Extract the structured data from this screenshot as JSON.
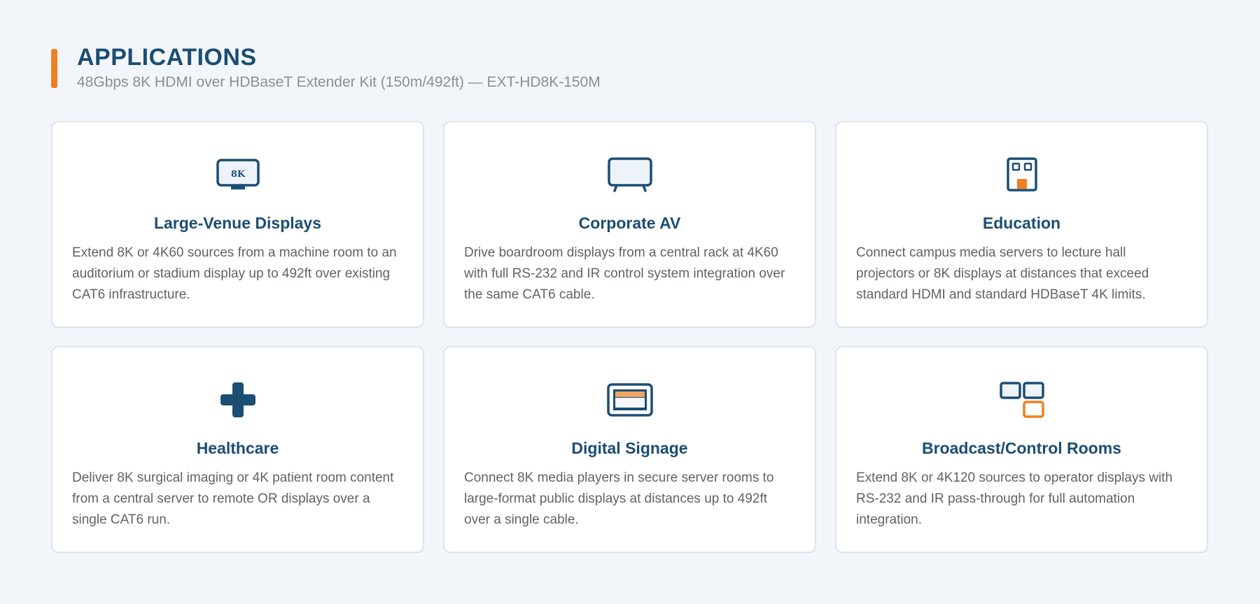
{
  "header": {
    "title": "APPLICATIONS",
    "subtitle": "48Gbps 8K HDMI over HDBaseT Extender Kit (150m/492ft) — EXT-HD8K-150M"
  },
  "colors": {
    "accent": "#f07f22",
    "primary": "#1c4d73",
    "text": "#5f6368",
    "background": "#f2f6fa"
  },
  "cards": [
    {
      "icon": "8k-monitor-icon",
      "icon_text": "8K",
      "title": "Large-Venue Displays",
      "description": "Extend 8K or 4K60 sources from a machine room to an auditorium or stadium display up to 492ft over existing CAT6 infrastructure."
    },
    {
      "icon": "tv-icon",
      "title": "Corporate AV",
      "description": "Drive boardroom displays from a central rack at 4K60 with full RS-232 and IR control system integration over the same CAT6 cable."
    },
    {
      "icon": "building-icon",
      "title": "Education",
      "description": "Connect campus media servers to lecture hall projectors or 8K displays at distances that exceed standard HDMI and standard HDBaseT 4K limits."
    },
    {
      "icon": "medical-cross-icon",
      "title": "Healthcare",
      "description": "Deliver 8K surgical imaging or 4K patient room content from a central server to remote OR displays over a single CAT6 run."
    },
    {
      "icon": "signage-screen-icon",
      "title": "Digital Signage",
      "description": "Connect 8K media players in secure server rooms to large-format public displays at distances up to 492ft over a single cable."
    },
    {
      "icon": "multi-screen-icon",
      "title": "Broadcast/Control Rooms",
      "description": "Extend 8K or 4K120 sources to operator displays with RS-232 and IR pass-through for full automation integration."
    }
  ]
}
